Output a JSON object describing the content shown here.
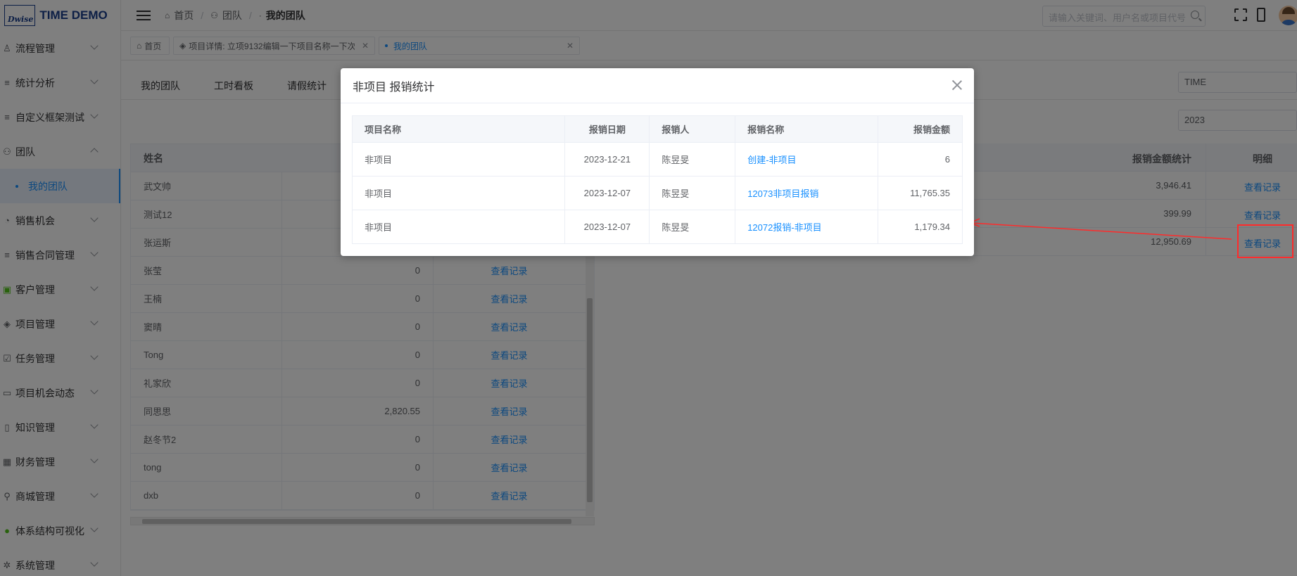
{
  "app": {
    "logo_mark": "Dwise",
    "title": "TIME DEMO"
  },
  "sidebar": {
    "items": [
      {
        "label": "流程管理",
        "icon": "user-icon"
      },
      {
        "label": "统计分析",
        "icon": "list-icon"
      },
      {
        "label": "自定义框架测试",
        "icon": "list-icon"
      },
      {
        "label": "团队",
        "icon": "team-icon",
        "expanded": true
      },
      {
        "label": "我的团队",
        "sub": true,
        "active": true
      },
      {
        "label": "销售机会",
        "icon": "pie-icon"
      },
      {
        "label": "销售合同管理",
        "icon": "list-icon"
      },
      {
        "label": "客户管理",
        "icon": "customer-icon"
      },
      {
        "label": "项目管理",
        "icon": "layers-icon"
      },
      {
        "label": "任务管理",
        "icon": "check-icon"
      },
      {
        "label": "项目机会动态",
        "icon": "calendar-icon"
      },
      {
        "label": "知识管理",
        "icon": "book-icon"
      },
      {
        "label": "财务管理",
        "icon": "grid-icon"
      },
      {
        "label": "商城管理",
        "icon": "bike-icon"
      },
      {
        "label": "体系结构可视化",
        "icon": "people-icon"
      },
      {
        "label": "系统管理",
        "icon": "gear-icon"
      }
    ]
  },
  "header": {
    "breadcrumb": [
      "首页",
      "团队",
      "我的团队"
    ],
    "search_placeholder": "请输入关键词、用户名或项目代号"
  },
  "tabs": [
    {
      "label": "首页"
    },
    {
      "label": "项目详情: 立项9132编辑一下项目名称一下次",
      "closable": true
    },
    {
      "label": "我的团队",
      "closable": true,
      "active": true
    }
  ],
  "subnav": {
    "items": [
      "我的团队",
      "工时看板",
      "请假统计"
    ]
  },
  "filters": {
    "org": "TIME",
    "year": "2023"
  },
  "left_table": {
    "header_name": "姓名",
    "rows": [
      {
        "name": "武文帅",
        "value": "",
        "link": ""
      },
      {
        "name": "测试12",
        "value": "",
        "link": ""
      },
      {
        "name": "张运斯",
        "value": "",
        "link": ""
      },
      {
        "name": "张莹",
        "value": "0",
        "link": "查看记录"
      },
      {
        "name": "王楠",
        "value": "0",
        "link": "查看记录"
      },
      {
        "name": "窦晴",
        "value": "0",
        "link": "查看记录"
      },
      {
        "name": "Tong",
        "value": "0",
        "link": "查看记录"
      },
      {
        "name": "礼家欣",
        "value": "0",
        "link": "查看记录"
      },
      {
        "name": "同思思",
        "value": "2,820.55",
        "link": "查看记录"
      },
      {
        "name": "赵冬节2",
        "value": "0",
        "link": "查看记录"
      },
      {
        "name": "tong",
        "value": "0",
        "link": "查看记录"
      },
      {
        "name": "dxb",
        "value": "0",
        "link": "查看记录"
      }
    ]
  },
  "right_table": {
    "header_sum": "报销金额统计",
    "header_detail": "明细",
    "rows": [
      {
        "sum": "3,946.41",
        "link": "查看记录"
      },
      {
        "sum": "399.99",
        "link": "查看记录"
      },
      {
        "sum": "12,950.69",
        "link": "查看记录"
      }
    ]
  },
  "dialog": {
    "title": "非项目 报销统计",
    "columns": [
      "项目名称",
      "报销日期",
      "报销人",
      "报销名称",
      "报销金额"
    ],
    "rows": [
      {
        "project": "非项目",
        "date": "2023-12-21",
        "person": "陈昱旻",
        "name": "创建-非项目",
        "amount": "6"
      },
      {
        "project": "非项目",
        "date": "2023-12-07",
        "person": "陈昱旻",
        "name": "12073非项目报销",
        "amount": "11,765.35"
      },
      {
        "project": "非项目",
        "date": "2023-12-07",
        "person": "陈昱旻",
        "name": "12072报销-非项目",
        "amount": "1,179.34"
      }
    ]
  },
  "annotation": {
    "color": "#ff2b2b"
  }
}
